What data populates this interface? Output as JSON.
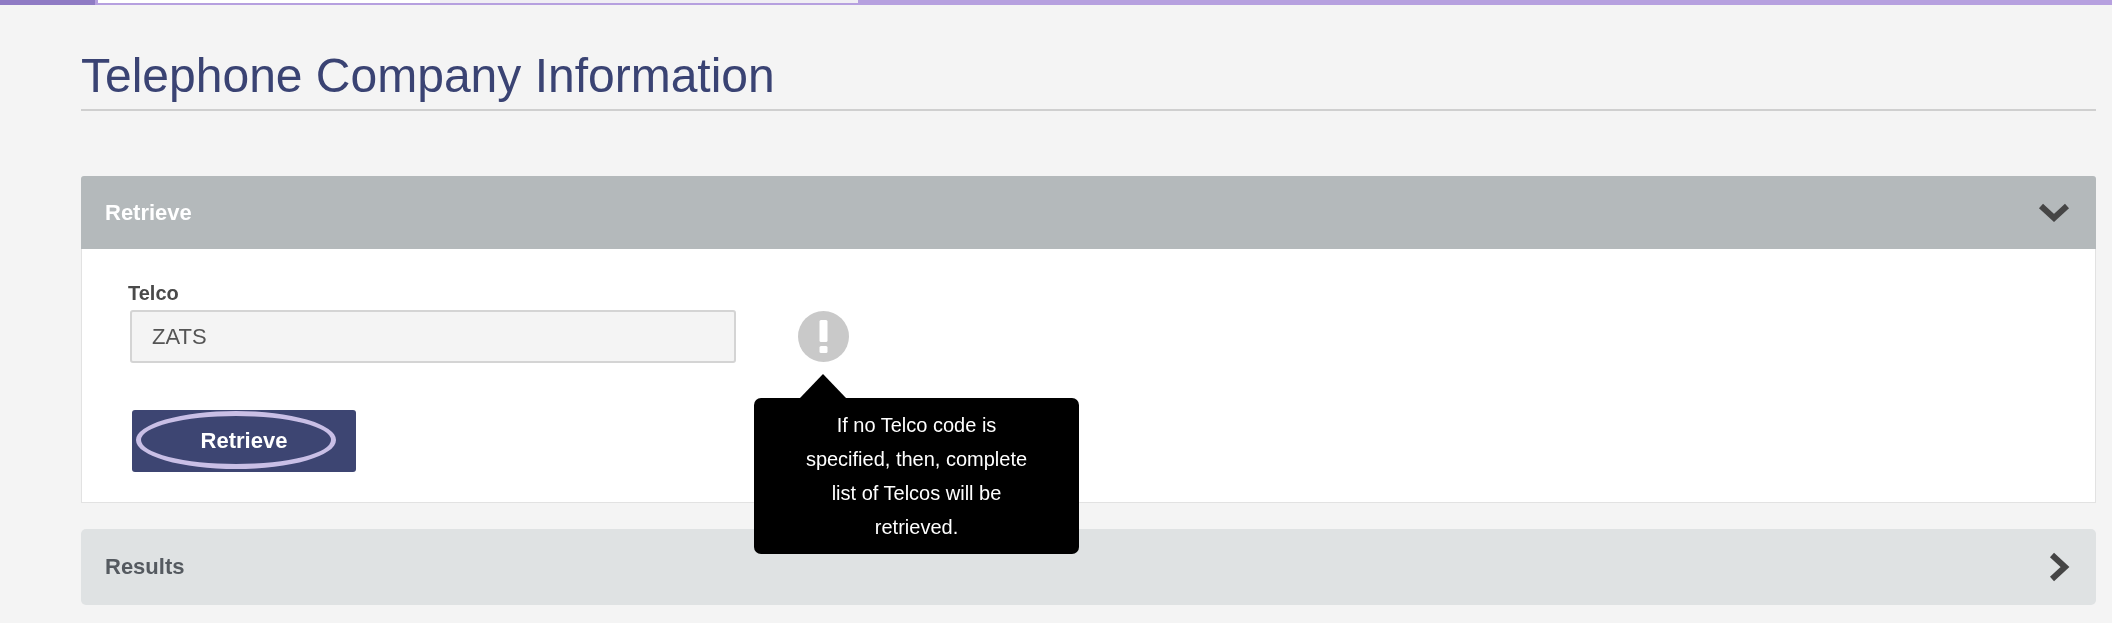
{
  "page": {
    "title": "Telephone Company Information"
  },
  "retrieve_panel": {
    "title": "Retrieve",
    "expanded": true,
    "fields": [
      {
        "label": "Telco",
        "value": "ZATS"
      }
    ],
    "info_tooltip": {
      "text": "If no Telco code is specified, then, complete list of Telcos will be retrieved."
    },
    "button": {
      "label": "Retrieve",
      "focused": true
    }
  },
  "results_panel": {
    "title": "Results",
    "expanded": false
  }
}
